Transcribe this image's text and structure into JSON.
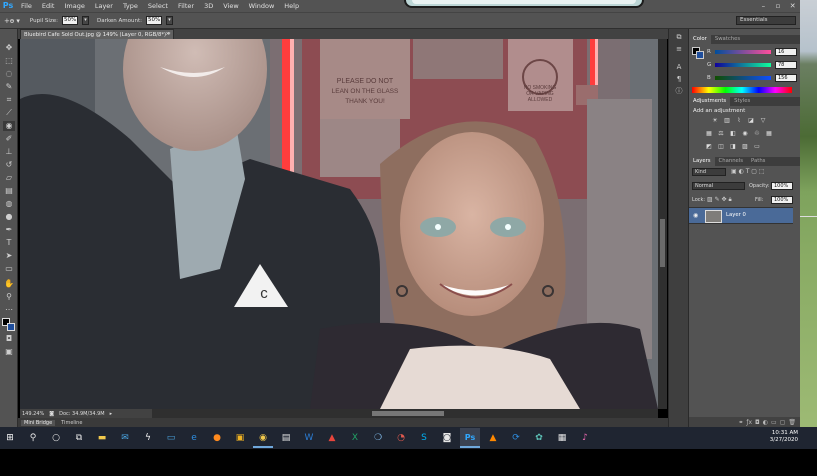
{
  "app": {
    "logo": "Ps",
    "menu": [
      "File",
      "Edit",
      "Image",
      "Layer",
      "Type",
      "Select",
      "Filter",
      "3D",
      "View",
      "Window",
      "Help"
    ]
  },
  "options_bar": {
    "pupil_size_label": "Pupil Size:",
    "pupil_size_value": "50%",
    "darken_amount_label": "Darken Amount:",
    "darken_amount_value": "50%",
    "workspace": "Essentials"
  },
  "document": {
    "tab_title": "Bluebird Cafe Sold Out.jpg @ 149% (Layer 0, RGB/8*) *",
    "tab_close": "×",
    "zoom": "149.24%",
    "doc_size": "Doc: 34.9M/34.9M",
    "bottom_tabs": [
      "Mini Bridge",
      "Timeline"
    ]
  },
  "photo_text": {
    "sign_left": [
      "PLEASE DO NOT",
      "LEAN ON THE GLASS",
      "THANK YOU!"
    ],
    "sign_right": [
      "NO SMOKING",
      "OR VAPING",
      "ALLOWED"
    ]
  },
  "color_panel": {
    "tabs": [
      "Color",
      "Swatches"
    ],
    "channels": [
      {
        "label": "R",
        "value": "16"
      },
      {
        "label": "G",
        "value": "78"
      },
      {
        "label": "B",
        "value": "156"
      }
    ]
  },
  "adjustments_panel": {
    "tabs": [
      "Adjustments",
      "Styles"
    ],
    "heading": "Add an adjustment"
  },
  "layers_panel": {
    "tabs": [
      "Layers",
      "Channels",
      "Paths"
    ],
    "kind": "Kind",
    "blend_mode": "Normal",
    "opacity_label": "Opacity:",
    "opacity_value": "100%",
    "lock_label": "Lock:",
    "fill_label": "Fill:",
    "fill_value": "100%",
    "layers": [
      {
        "name": "Layer 0"
      }
    ]
  },
  "taskbar": {
    "time": "10:31 AM",
    "date": "3/27/2020"
  },
  "colors": {
    "ps_blue": "#31a8ff",
    "panel_bg": "#535353",
    "selected_layer": "#4a6a98",
    "taskbar": "#1f2531"
  }
}
